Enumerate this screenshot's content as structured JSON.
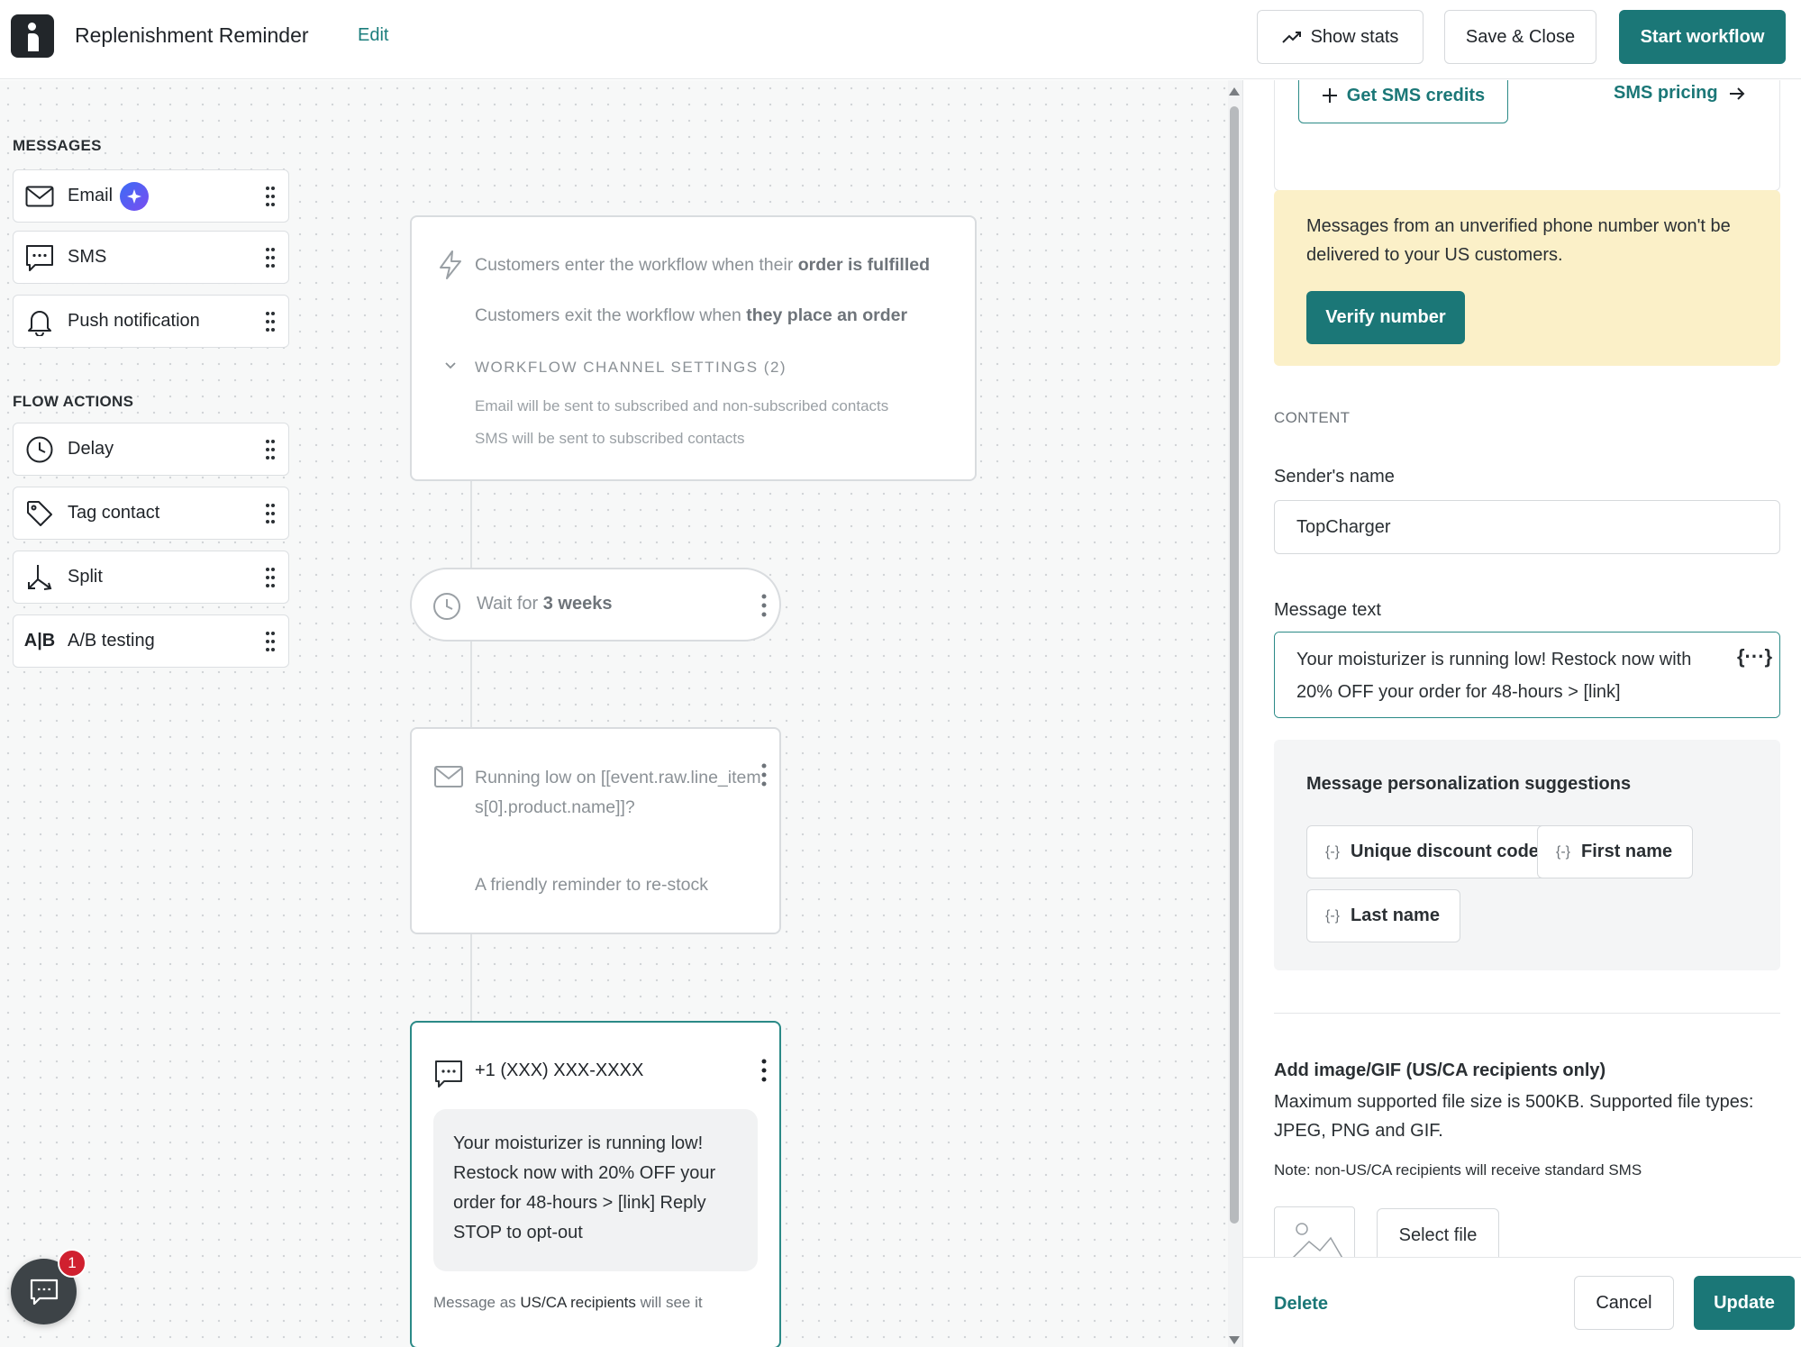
{
  "header": {
    "title": "Replenishment Reminder",
    "edit_label": "Edit",
    "show_stats_label": "Show stats",
    "save_close_label": "Save & Close",
    "start_workflow_label": "Start workflow"
  },
  "palette": {
    "messages_heading": "MESSAGES",
    "messages": [
      {
        "label": "Email",
        "icon": "envelope-icon"
      },
      {
        "label": "SMS",
        "icon": "chat-bubble-icon"
      },
      {
        "label": "Push notification",
        "icon": "bell-icon"
      }
    ],
    "flow_heading": "FLOW ACTIONS",
    "flow_actions": [
      {
        "label": "Delay",
        "icon": "clock-icon"
      },
      {
        "label": "Tag contact",
        "icon": "tag-icon"
      },
      {
        "label": "Split",
        "icon": "split-arrow-icon"
      },
      {
        "label": "A/B testing",
        "icon": "ab-icon",
        "icon_text": "A|B"
      }
    ]
  },
  "trigger": {
    "enter_prefix": "Customers enter the workflow when their ",
    "enter_bold": "order is fulfilled",
    "exit_prefix": "Customers exit the workflow when ",
    "exit_bold": "they place an order",
    "channel_settings_title": "WORKFLOW CHANNEL SETTINGS (2)",
    "email_setting": "Email will be sent to subscribed and non-subscribed contacts",
    "sms_setting": "SMS will be sent to subscribed contacts"
  },
  "wait": {
    "prefix": "Wait for ",
    "bold": "3 weeks"
  },
  "email_node": {
    "subject": "Running low on [[event.raw.line_items[0].product.name]]?",
    "preview": "A friendly reminder to re-stock"
  },
  "sms_node": {
    "phone": "+1 (XXX) XXX-XXXX",
    "message": "Your moisturizer is running low! Restock now with 20% OFF your order for 48-hours > [link] Reply STOP to opt-out",
    "footer_prefix": "Message as ",
    "footer_bold": "US/CA recipients",
    "footer_suffix": " will see it"
  },
  "chat": {
    "badge_count": "1"
  },
  "panel": {
    "get_credits_label": "Get SMS credits",
    "sms_pricing_label": "SMS pricing",
    "warning_text": "Messages from an unverified phone number won't be delivered to your US customers.",
    "verify_label": "Verify number",
    "content_heading": "CONTENT",
    "sender_label": "Sender's name",
    "sender_value": "TopCharger",
    "message_label": "Message text",
    "message_value": "Your moisturizer is running low! Restock now with 20% OFF your order for 48-hours > [link]",
    "variable_icon_text": "{···}",
    "suggestions_title": "Message personalization suggestions",
    "chip_icon_text": "{-}",
    "suggestions": [
      "Unique discount code",
      "First name",
      "Last name"
    ],
    "image_title": "Add image/GIF (US/CA recipients only)",
    "image_desc": "Maximum supported file size is 500KB. Supported file types: JPEG, PNG and GIF.",
    "image_note": "Note: non-US/CA recipients will receive standard SMS",
    "select_file_label": "Select file",
    "delete_label": "Delete",
    "cancel_label": "Cancel",
    "update_label": "Update"
  },
  "colors": {
    "brand_teal": "#1b7777",
    "warning_bg": "#fbf0c8",
    "badge_red": "#d0202f"
  }
}
